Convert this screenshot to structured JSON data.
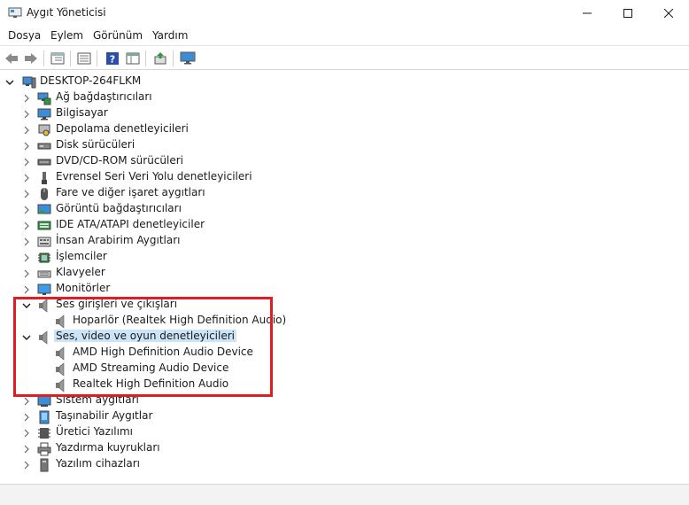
{
  "window": {
    "title": "Aygıt Yöneticisi",
    "accent": "#e31b23",
    "selection_color": "#cce4f7"
  },
  "menu": [
    "Dosya",
    "Eylem",
    "Görünüm",
    "Yardım"
  ],
  "toolbar": [
    "back-icon",
    "forward-icon",
    "properties-icon",
    "view-icon",
    "help-icon",
    "grid-icon",
    "update-driver-icon",
    "monitor-icon"
  ],
  "tree": {
    "root": "DESKTOP-264FLKM",
    "categories": [
      {
        "label": "Ağ bağdaştırıcıları",
        "icon": "network-adapter-icon",
        "expanded": false
      },
      {
        "label": "Bilgisayar",
        "icon": "computer-icon",
        "expanded": false
      },
      {
        "label": "Depolama denetleyicileri",
        "icon": "storage-controller-icon",
        "expanded": false
      },
      {
        "label": "Disk sürücüleri",
        "icon": "disk-drive-icon",
        "expanded": false
      },
      {
        "label": "DVD/CD-ROM sürücüleri",
        "icon": "dvd-drive-icon",
        "expanded": false
      },
      {
        "label": "Evrensel Seri Veri Yolu denetleyicileri",
        "icon": "usb-icon",
        "expanded": false
      },
      {
        "label": "Fare ve diğer işaret aygıtları",
        "icon": "mouse-icon",
        "expanded": false
      },
      {
        "label": "Görüntü bağdaştırıcıları",
        "icon": "display-adapter-icon",
        "expanded": false
      },
      {
        "label": "IDE ATA/ATAPI denetleyiciler",
        "icon": "ide-controller-icon",
        "expanded": false
      },
      {
        "label": "İnsan Arabirim Aygıtları",
        "icon": "hid-icon",
        "expanded": false
      },
      {
        "label": "İşlemciler",
        "icon": "processor-icon",
        "expanded": false
      },
      {
        "label": "Klavyeler",
        "icon": "keyboard-icon",
        "expanded": false
      },
      {
        "label": "Monitörler",
        "icon": "monitor-icon",
        "expanded": false
      },
      {
        "label": "Ses girişleri ve çıkışları",
        "icon": "speaker-icon",
        "expanded": true,
        "children": [
          "Hoparlör (Realtek High Definition Audio)"
        ]
      },
      {
        "label": "Ses, video ve oyun denetleyicileri",
        "icon": "speaker-icon",
        "expanded": true,
        "selected": true,
        "children": [
          "AMD High Definition Audio Device",
          "AMD Streaming Audio Device",
          "Realtek High Definition Audio"
        ]
      },
      {
        "label": "Sistem aygıtları",
        "icon": "system-device-icon",
        "expanded": false
      },
      {
        "label": "Taşınabilir Aygıtlar",
        "icon": "portable-device-icon",
        "expanded": false
      },
      {
        "label": "Üretici Yazılımı",
        "icon": "firmware-icon",
        "expanded": false
      },
      {
        "label": "Yazdırma kuyrukları",
        "icon": "printer-icon",
        "expanded": false
      },
      {
        "label": "Yazılım cihazları",
        "icon": "software-device-icon",
        "expanded": false
      }
    ]
  }
}
